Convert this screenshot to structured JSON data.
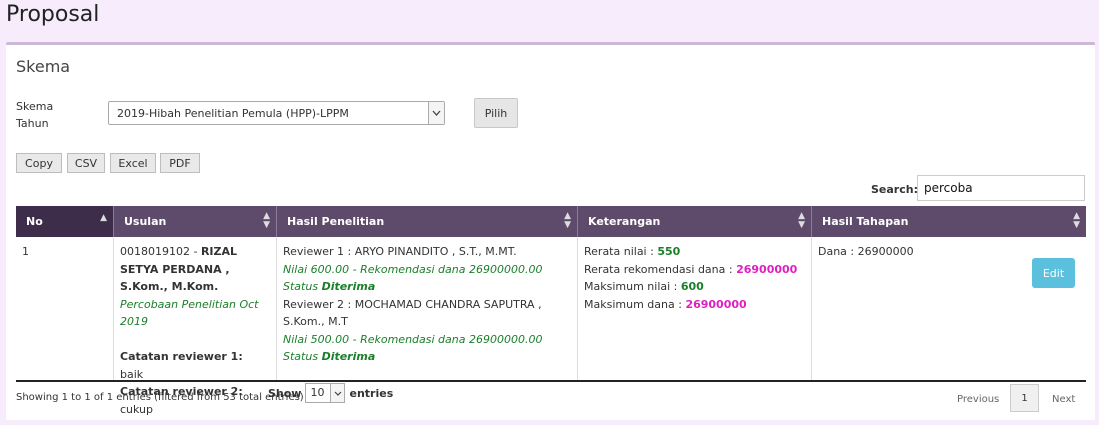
{
  "page": {
    "title": "Proposal"
  },
  "panel": {
    "title": "Skema"
  },
  "filters": {
    "skema_label": "Skema",
    "tahun_label": "Tahun",
    "selected": "2019-Hibah Penelitian Pemula (HPP)-LPPM",
    "pilih_label": "Pilih"
  },
  "export": {
    "copy": "Copy",
    "csv": "CSV",
    "excel": "Excel",
    "pdf": "PDF"
  },
  "search": {
    "label": "Search:",
    "value": "percoba"
  },
  "table": {
    "headers": [
      "No",
      "Usulan",
      "Hasil Penelitian",
      "Keterangan",
      "Hasil Tahapan"
    ],
    "row": {
      "no": "1",
      "usulan": {
        "id": "0018019102 - ",
        "name": "RIZAL SETYA PERDANA , S.Kom., M.Kom.",
        "proposal_title": "Percobaan Penelitian Oct 2019",
        "catatan1_label": "Catatan reviewer 1:",
        "catatan1": "baik",
        "catatan2_label": "Catatan reviewer 2:",
        "catatan2": "cukup"
      },
      "hasil": {
        "r1": "Reviewer 1 : ARYO PINANDITO , S.T., M.MT.",
        "r1_nilai": "Nilai 600.00 - Rekomendasi dana 26900000.00",
        "r1_status_prefix": "Status ",
        "r1_status": "Diterima",
        "r2": "Reviewer 2 : MOCHAMAD CHANDRA SAPUTRA , S.Kom., M.T",
        "r2_nilai": "Nilai 500.00 - Rekomendasi dana 26900000.00",
        "r2_status_prefix": "Status ",
        "r2_status": "Diterima"
      },
      "keterangan": {
        "rerata_nilai_label": "Rerata nilai : ",
        "rerata_nilai": "550",
        "rerata_dana_label": "Rerata rekomendasi dana : ",
        "rerata_dana": "26900000",
        "max_nilai_label": "Maksimum nilai : ",
        "max_nilai": "600",
        "max_dana_label": "Maksimum dana : ",
        "max_dana": "26900000"
      },
      "tahapan": {
        "dana": "Dana : 26900000",
        "edit_label": "Edit"
      }
    }
  },
  "footer": {
    "info": "Showing 1 to 1 of 1 entries (filtered from 53 total entries)",
    "show_label": "Show",
    "entries_value": "10",
    "entries_label": "entries",
    "previous": "Previous",
    "page": "1",
    "next": "Next"
  },
  "colors": {
    "header_bg": "#5e4a6b",
    "sorted_header_bg": "#3e2d4a",
    "green": "#1a7f2a",
    "magenta": "#e01fc2",
    "edit_btn": "#5bc0de"
  }
}
